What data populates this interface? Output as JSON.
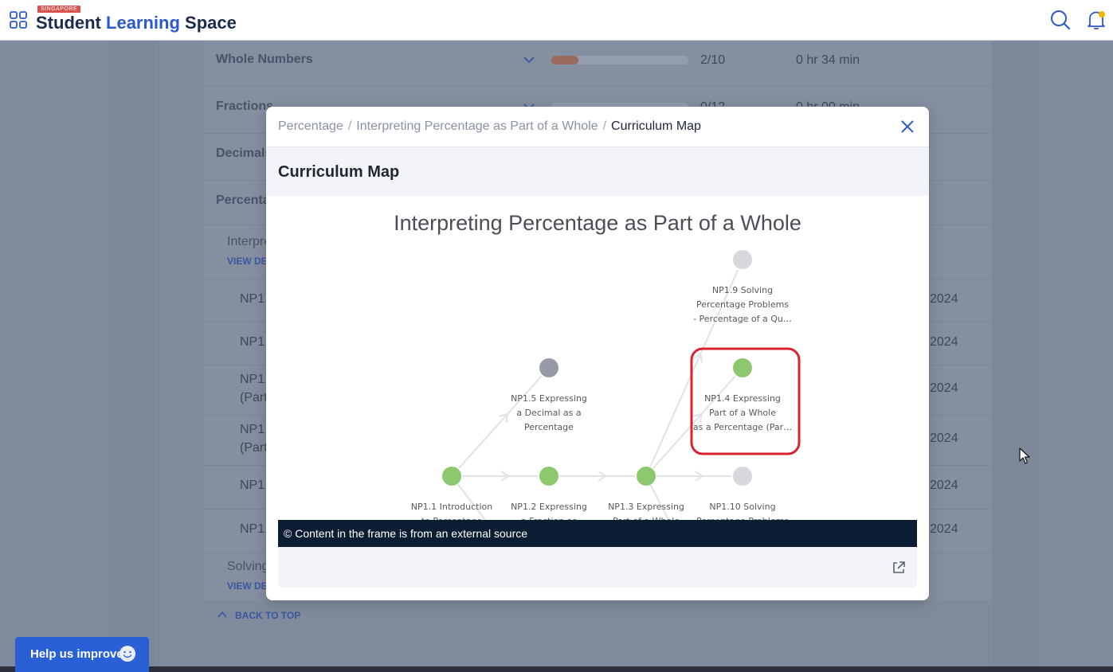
{
  "header": {
    "brand_tag": "SINGAPORE",
    "brand_word1": "Student",
    "brand_word2": "Learning",
    "brand_word3": "Space"
  },
  "background_page": {
    "topics": [
      {
        "name": "Whole Numbers",
        "progress": "2/10",
        "progress_fraction": 0.2,
        "time": "0 hr 34 min"
      },
      {
        "name": "Fractions",
        "progress": "0/12",
        "progress_fraction": 0.0,
        "time": "0 hr 00 min"
      },
      {
        "name": "Decimals"
      },
      {
        "name": "Percenta"
      }
    ],
    "sub_section_1": {
      "title": "Interpre",
      "link": "VIEW DE"
    },
    "items": [
      {
        "code": "NP1.",
        "year": "2024"
      },
      {
        "code": "NP1.",
        "year": "2024"
      },
      {
        "code": "NP1.",
        "code2": "(Part",
        "year": "2024"
      },
      {
        "code": "NP1.",
        "code2": "(Part",
        "year": "2024"
      },
      {
        "code": "NP1.",
        "year": "2024"
      },
      {
        "code": "NP1.",
        "year": "2024"
      }
    ],
    "sub_section_2": {
      "title": "Solving",
      "link": "VIEW DE"
    },
    "back_to_top": "BACK TO TOP"
  },
  "help_button": {
    "label": "Help us improve"
  },
  "modal": {
    "breadcrumb": [
      "Percentage",
      "Interpreting Percentage as Part of a Whole",
      "Curriculum Map"
    ],
    "breadcrumb_separator": "/",
    "title": "Curriculum Map",
    "external_notice": "© Content in the frame is from an external source",
    "map": {
      "heading": "Interpreting Percentage as Part of a Whole",
      "nodes": [
        {
          "id": "np19",
          "status": "not-started",
          "label_lines": [
            "NP1.9 Solving",
            "Percentage Problems",
            "- Percentage of a Qu…"
          ]
        },
        {
          "id": "np15",
          "status": "locked",
          "label_lines": [
            "NP1.5 Expressing",
            "a Decimal as a",
            "Percentage"
          ]
        },
        {
          "id": "np14",
          "status": "completed",
          "highlighted": true,
          "label_lines": [
            "NP1.4 Expressing",
            "Part of a Whole",
            "as a Percentage (Par…"
          ]
        },
        {
          "id": "np11",
          "status": "completed",
          "label_lines": [
            "NP1.1 Introduction",
            "to Percentage"
          ]
        },
        {
          "id": "np12",
          "status": "completed",
          "label_lines": [
            "NP1.2 Expressing",
            "a Fraction as"
          ]
        },
        {
          "id": "np13",
          "status": "completed",
          "label_lines": [
            "NP1.3 Expressing",
            "Part of a Whole"
          ]
        },
        {
          "id": "np110",
          "status": "not-started",
          "label_lines": [
            "NP1.10 Solving",
            "Percentage Problems"
          ]
        }
      ],
      "colors": {
        "completed": "#8dc86f",
        "not-started": "#d6d8dd",
        "locked": "#959aa5",
        "edge": "#e3e4e7",
        "highlight": "#d9232d"
      }
    }
  },
  "colors": {
    "accent": "#2a60d6",
    "brand_dark": "#1b2b4b",
    "brand_blue": "#2a59c9",
    "overlay_bg": "#7f8b9c",
    "banner_bg": "#0b1d33"
  },
  "icons": [
    "apps-grid-icon",
    "search-icon",
    "bell-icon",
    "chevron-down-icon",
    "close-icon",
    "external-link-icon",
    "smiley-icon",
    "chevron-up-icon",
    "mouse-cursor-icon"
  ]
}
